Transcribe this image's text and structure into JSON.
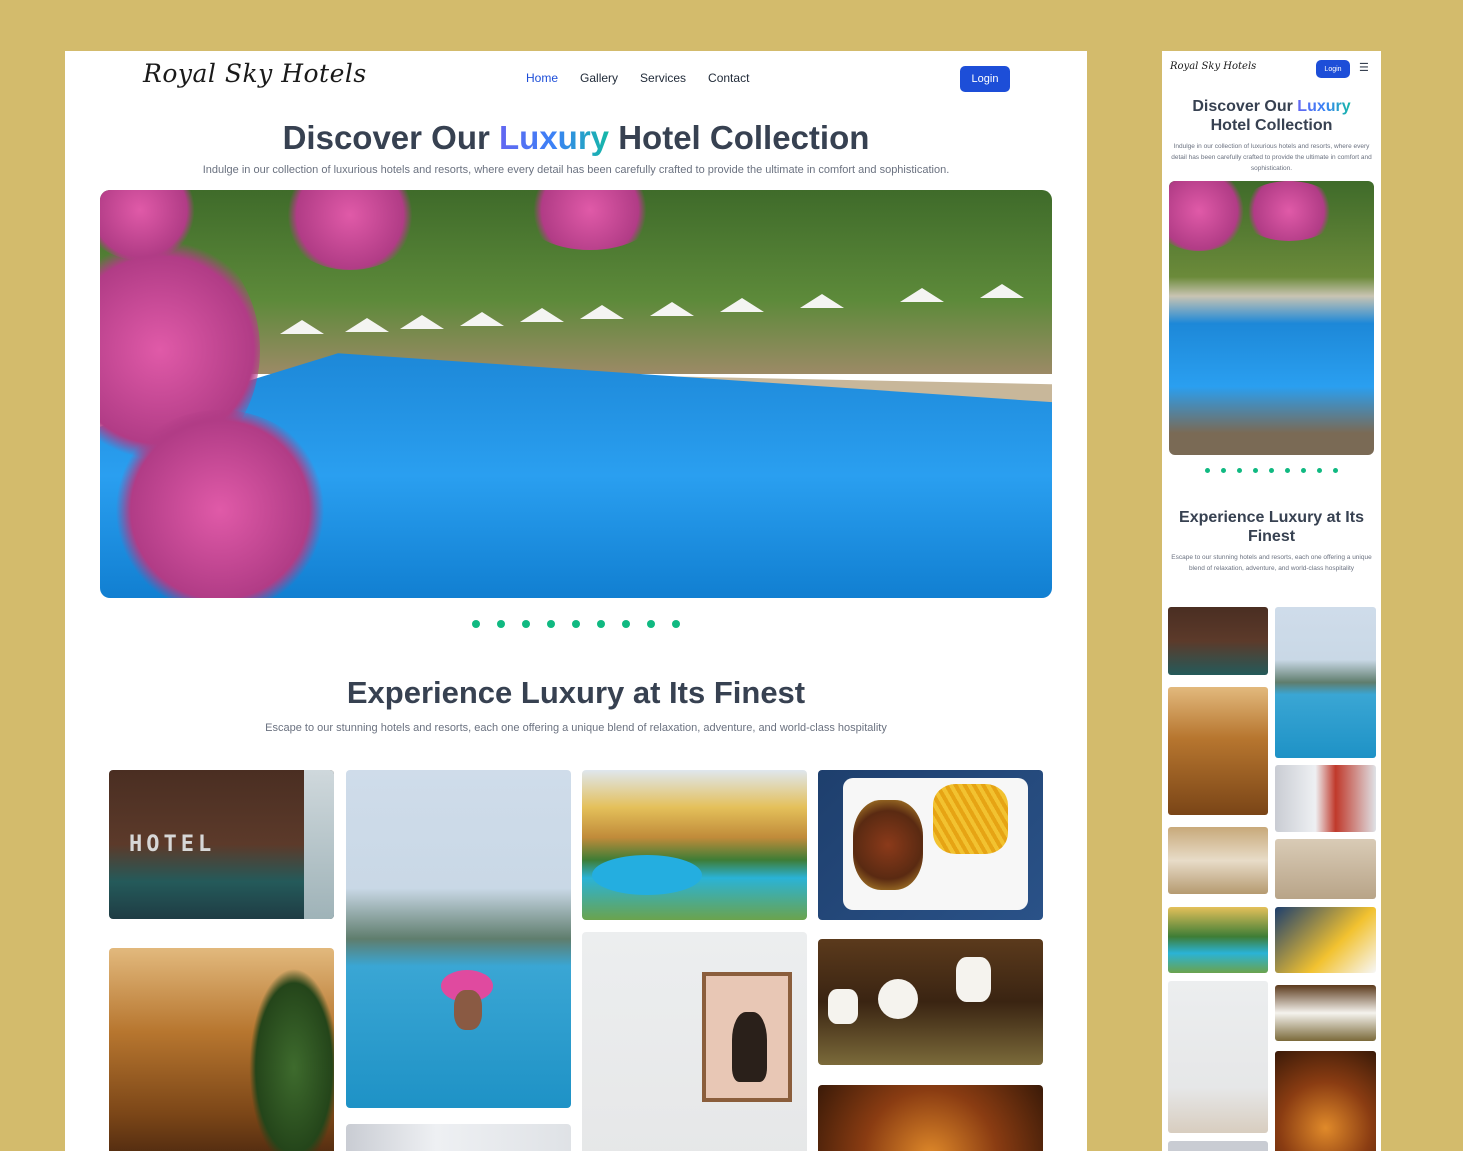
{
  "brand": "Royal Sky Hotels",
  "nav": {
    "items": [
      "Home",
      "Gallery",
      "Services",
      "Contact"
    ],
    "active": "Home",
    "login_label": "Login"
  },
  "hero": {
    "title_before": "Discover Our",
    "title_highlight": "Luxury",
    "title_after": "Hotel Collection",
    "subtitle": "Indulge in our collection of luxurious hotels and resorts, where every detail has been carefully crafted to provide the ultimate in comfort and sophistication.",
    "slide_count": 9
  },
  "gallery": {
    "title": "Experience Luxury at Its Finest",
    "subtitle": "Escape to our stunning hotels and resorts, each one offering a unique blend of relaxation, adventure, and world-class hospitality",
    "hotel_sign": "HOTEL",
    "images": [
      "hotel-lounge",
      "palm-pool-swimmer",
      "resort-pool",
      "kebab-fries-plate",
      "palace-hallway",
      "bedroom-artwork",
      "tea-set-table",
      "bedroom-canopy",
      "warm-dining"
    ]
  },
  "mobile": {
    "menu_icon": "hamburger-icon"
  },
  "colors": {
    "accent": "#1d4ed8",
    "dot": "#10b981",
    "background": "#d3bb6c",
    "heading": "#374151"
  }
}
